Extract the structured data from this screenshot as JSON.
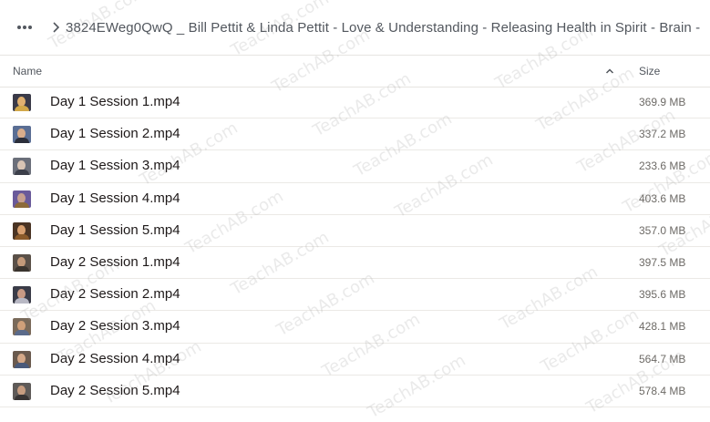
{
  "breadcrumb": {
    "more_icon": "more-horizontal-icon",
    "separator_icon": "chevron-right-icon",
    "path": "3824EWeg0QwQ _ Bill Pettit & Linda Pettit - Love & Understanding - Releasing Health in Spirit - Brain -"
  },
  "table": {
    "col_name": "Name",
    "col_size": "Size",
    "sort_icon": "sort-ascending-icon",
    "rows": [
      {
        "name": "Day 1 Session 1.mp4",
        "size": "369.9 MB"
      },
      {
        "name": "Day 1 Session 2.mp4",
        "size": "337.2 MB"
      },
      {
        "name": "Day 1 Session 3.mp4",
        "size": "233.6 MB"
      },
      {
        "name": "Day 1 Session 4.mp4",
        "size": "403.6 MB"
      },
      {
        "name": "Day 1 Session 5.mp4",
        "size": "357.0 MB"
      },
      {
        "name": "Day 2 Session 1.mp4",
        "size": "397.5 MB"
      },
      {
        "name": "Day 2 Session 2.mp4",
        "size": "395.6 MB"
      },
      {
        "name": "Day 2 Session 3.mp4",
        "size": "428.1 MB"
      },
      {
        "name": "Day 2 Session 4.mp4",
        "size": "564.7 MB"
      },
      {
        "name": "Day 2 Session 5.mp4",
        "size": "578.4 MB"
      }
    ]
  },
  "watermark": "TeachAB.com"
}
